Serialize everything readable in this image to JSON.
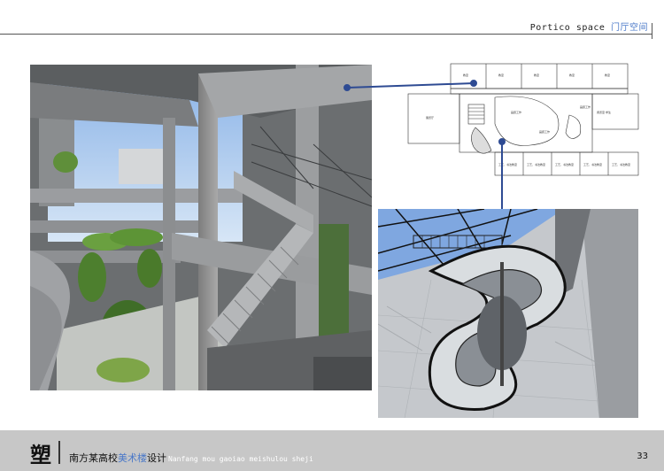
{
  "header": {
    "title_en": "Portico space",
    "title_zh": "门厅空间"
  },
  "plan": {
    "rooms": {
      "top": [
        "教室",
        "教室",
        "教室",
        "教室",
        "教室"
      ],
      "left_hall": "展览厅",
      "center_a": "画廊工作",
      "center_b": "画廊工作",
      "center_c": "画廊工作",
      "right_room": "阅览室·学生",
      "bottom": [
        "工艺、书法教室",
        "工艺、书法教室",
        "工艺、书法教室",
        "工艺、书法教室",
        "工艺、书法教室"
      ]
    }
  },
  "footer": {
    "mark": "塑",
    "text_plain": "南方某高校",
    "text_accent": "美术楼",
    "text_tail": "设计",
    "pinyin": "Nanfang mou gaoiao meishulou sheji",
    "page_number": "33"
  },
  "colors": {
    "accent": "#4a78c8",
    "connector": "#2e4b93",
    "footer_bg": "#c7c7c7"
  }
}
